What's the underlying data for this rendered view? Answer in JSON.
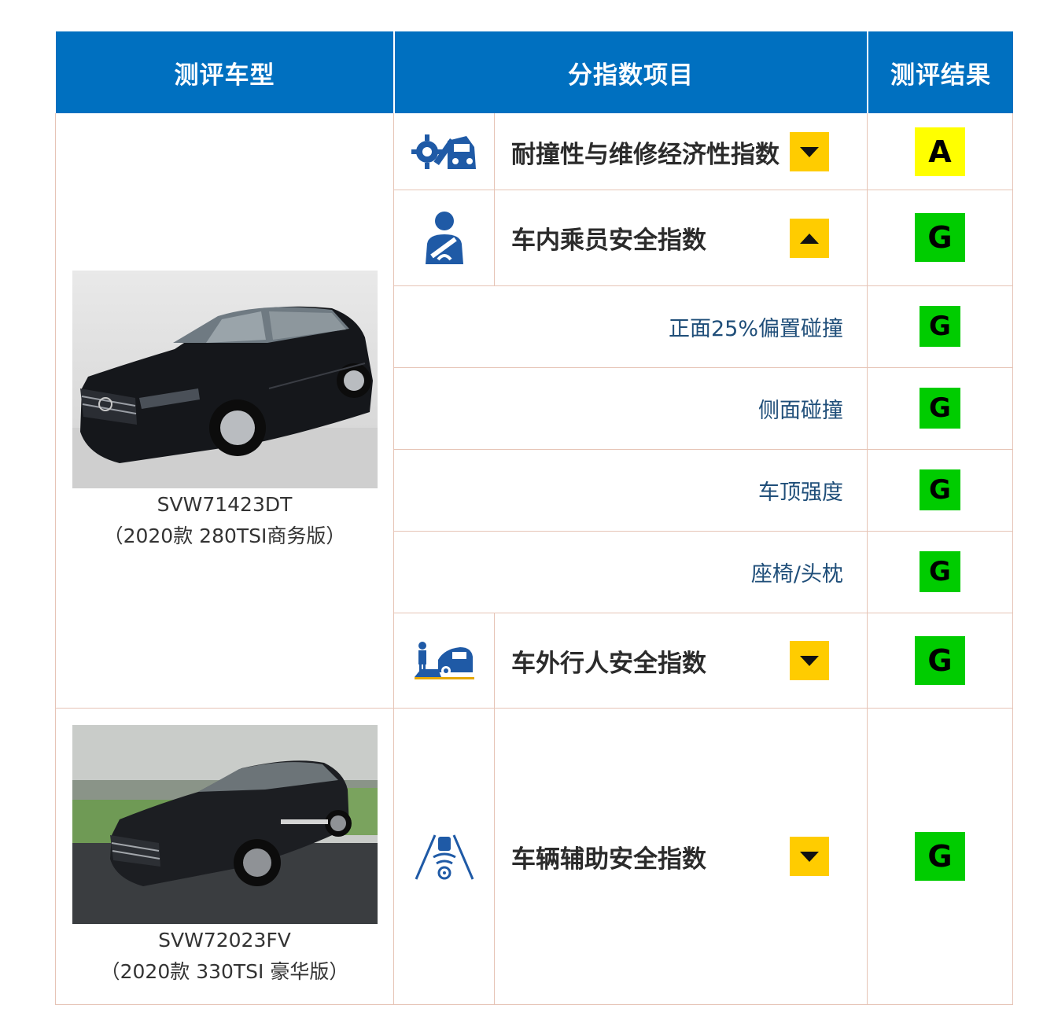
{
  "header": {
    "col_vehicle": "测评车型",
    "col_items": "分指数项目",
    "col_result": "测评结果"
  },
  "vehicles": [
    {
      "model_code": "SVW71423DT",
      "trim": "（2020款 280TSI商务版）"
    },
    {
      "model_code": "SVW72023FV",
      "trim": "（2020款 330TSI 豪华版）"
    }
  ],
  "categories": {
    "crash": {
      "label": "耐撞性与维修经济性指数",
      "grade": "A",
      "grade_color": "#ffff00",
      "icon": "crash-repair-icon",
      "expanded": false
    },
    "occupant": {
      "label": "车内乘员安全指数",
      "grade": "G",
      "grade_color": "#00cc00",
      "icon": "seatbelt-occupant-icon",
      "expanded": true
    },
    "pedestrian": {
      "label": "车外行人安全指数",
      "grade": "G",
      "grade_color": "#00cc00",
      "icon": "pedestrian-car-icon",
      "expanded": false
    },
    "assist": {
      "label": "车辆辅助安全指数",
      "grade": "G",
      "grade_color": "#00cc00",
      "icon": "driver-assist-icon",
      "expanded": false
    }
  },
  "occupant_subitems": [
    {
      "label": "正面25%偏置碰撞",
      "grade": "G"
    },
    {
      "label": "侧面碰撞",
      "grade": "G"
    },
    {
      "label": "车顶强度",
      "grade": "G"
    },
    {
      "label": "座椅/头枕",
      "grade": "G"
    }
  ],
  "colors": {
    "header_bg": "#0070c0",
    "toggle": "#ffcc00",
    "grade_A": "#ffff00",
    "grade_G": "#00cc00"
  }
}
